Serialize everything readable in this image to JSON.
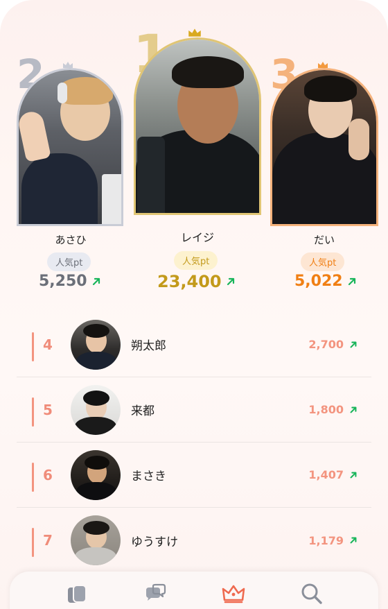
{
  "podium": {
    "first": {
      "rank": "1",
      "name": "レイジ",
      "pill": "人気pt",
      "score": "23,400",
      "color": "#c39a1b"
    },
    "second": {
      "rank": "2",
      "name": "あさひ",
      "pill": "人気pt",
      "score": "5,250",
      "color": "#6b6f78"
    },
    "third": {
      "rank": "3",
      "name": "だい",
      "pill": "人気pt",
      "score": "5,022",
      "color": "#f07f14"
    }
  },
  "list": [
    {
      "rank": "4",
      "name": "朔太郎",
      "score": "2,700"
    },
    {
      "rank": "5",
      "name": "来都",
      "score": "1,800"
    },
    {
      "rank": "6",
      "name": "まさき",
      "score": "1,407"
    },
    {
      "rank": "7",
      "name": "ゆうすけ",
      "score": "1,179"
    }
  ],
  "tabbar": {
    "tabs": [
      {
        "icon": "cards-icon",
        "active": false
      },
      {
        "icon": "chat-bubbles-icon",
        "active": false
      },
      {
        "icon": "crown-icon",
        "active": true
      },
      {
        "icon": "search-icon",
        "active": false
      }
    ]
  },
  "colors": {
    "gold": "#d9b55a",
    "silver": "#c9ccd6",
    "bronze": "#f4b27c",
    "list_accent": "#f3947f",
    "trend_up": "#18b55a"
  }
}
